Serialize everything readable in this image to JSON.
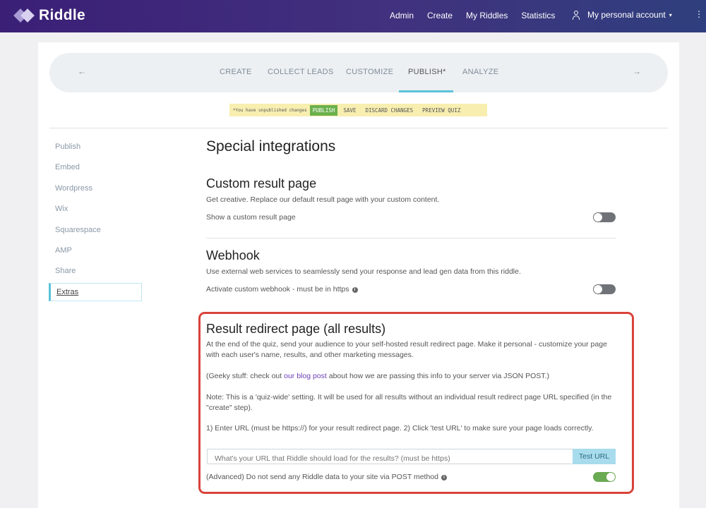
{
  "navbar": {
    "logo_text": "Riddle",
    "links": [
      "Admin",
      "Create",
      "My Riddles",
      "Statistics"
    ],
    "account_label": "My personal account",
    "caret": "▾",
    "more": "⋮"
  },
  "steps": {
    "prev": "←",
    "next": "→",
    "items": [
      "CREATE",
      "COLLECT LEADS",
      "CUSTOMIZE",
      "PUBLISH*",
      "ANALYZE"
    ],
    "active": "PUBLISH*"
  },
  "unpublished_bar": {
    "message": "*You have unpublished changes",
    "publish": "PUBLISH",
    "save": "SAVE",
    "discard": "DISCARD CHANGES",
    "preview": "PREVIEW QUIZ"
  },
  "sidebar": {
    "items": [
      "Publish",
      "Embed",
      "Wordpress",
      "Wix",
      "Squarespace",
      "AMP",
      "Share",
      "Extras"
    ],
    "active": "Extras"
  },
  "content": {
    "title": "Special integrations",
    "custom_result": {
      "heading": "Custom result page",
      "description": "Get creative. Replace our default result page with your custom content.",
      "toggle_label": "Show a custom result page",
      "toggle_on": false
    },
    "webhook": {
      "heading": "Webhook",
      "description": "Use external web services to seamlessly send your response and lead gen data from this riddle.",
      "toggle_label": "Activate custom webhook - must be in https",
      "toggle_on": false
    },
    "redirect": {
      "heading": "Result redirect page (all results)",
      "description": "At the end of the quiz, send your audience to your self-hosted result redirect page. Make it personal - customize your page with each user's name, results, and other marketing messages.",
      "geeky_before": "(Geeky stuff: check out ",
      "geeky_link": "our blog post",
      "geeky_after": " about how we are passing this info to your server via JSON POST.)",
      "note": "Note: This is a 'quiz-wide' setting. It will be used for all results without an individual result redirect page URL specified (in the \"create\" step).",
      "instructions": "1) Enter URL (must be https://) for your result redirect page. 2) Click 'test URL' to make sure your page loads correctly.",
      "url_placeholder": "What's your URL that Riddle should load for the results? (must be https)",
      "test_button": "Test URL",
      "advanced_label": "(Advanced) Do not send any Riddle data to your site via POST method",
      "advanced_on": true
    },
    "info_glyph": "i"
  },
  "colors": {
    "nav_gradient_start": "#3b1f77",
    "nav_gradient_end": "#2f3f7e",
    "accent": "#5bc3d8",
    "highlight_border": "#d9433a",
    "toggle_on": "#6aaa52",
    "link": "#6b3fb8"
  }
}
